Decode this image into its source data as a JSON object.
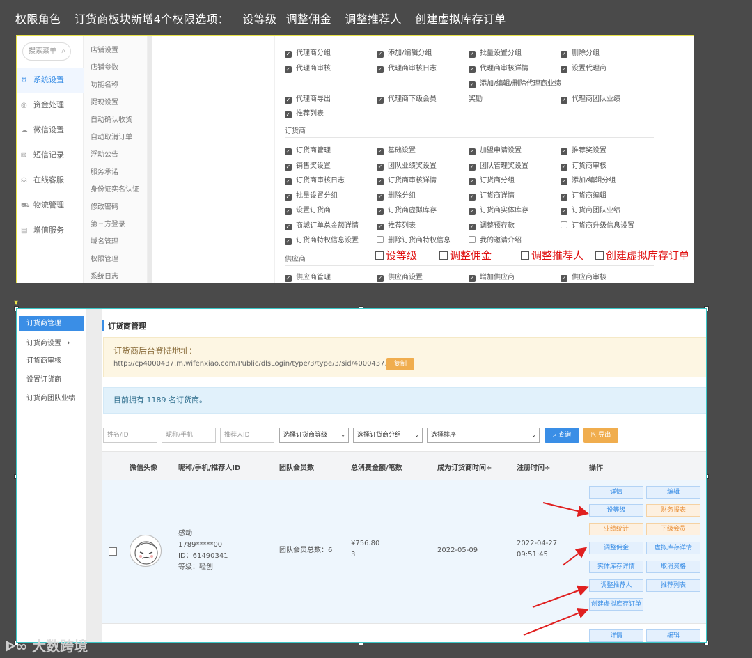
{
  "heading": {
    "part1": "权限角色",
    "part2": "订货商板块新增4个权限选项：",
    "part3": "设等级",
    "part4": "调整佣金",
    "part5": "调整推荐人",
    "part6": "创建虚拟库存订单"
  },
  "top_shot": {
    "search_placeholder": "搜索菜单",
    "nav": [
      {
        "label": "系统设置",
        "icon": "gear-icon",
        "active": true
      },
      {
        "label": "资金处理",
        "icon": "coin-icon"
      },
      {
        "label": "微信设置",
        "icon": "wechat-icon"
      },
      {
        "label": "短信记录",
        "icon": "mail-icon"
      },
      {
        "label": "在线客服",
        "icon": "headset-icon"
      },
      {
        "label": "物流管理",
        "icon": "truck-icon"
      },
      {
        "label": "增值服务",
        "icon": "chart-icon"
      }
    ],
    "subnav": [
      "店铺设置",
      "店铺参数",
      "功能名称",
      "提现设置",
      "自动确认收货",
      "自动取消订单",
      "浮动公告",
      "服务承诺",
      "身份证实名认证",
      "修改密码",
      "第三方登录",
      "域名管理",
      "权限管理",
      "系统日志"
    ],
    "agent_rows": [
      [
        "代理商分组",
        "添加/编辑分组",
        "批量设置分组",
        "删除分组"
      ],
      [
        "代理商审核",
        "代理商审核日志",
        "代理商审核详情",
        "设置代理商"
      ],
      [
        "",
        "",
        "添加/编辑/删除代理商业绩",
        ""
      ],
      [
        "代理商导出",
        "代理商下级会员",
        "奖励",
        "代理商团队业绩"
      ],
      [
        "推荐列表",
        "",
        "",
        ""
      ]
    ],
    "section_dealer": "订货商",
    "dealer_rows": [
      [
        "订货商管理",
        "基础设置",
        "加盟申请设置",
        "推荐奖设置"
      ],
      [
        "销售奖设置",
        "团队业绩奖设置",
        "团队管理奖设置",
        "订货商审核"
      ],
      [
        "订货商审核日志",
        "订货商审核详情",
        "订货商分组",
        "添加/编辑分组"
      ],
      [
        "批量设置分组",
        "删除分组",
        "订货商详情",
        "订货商编辑"
      ],
      [
        "设置订货商",
        "订货商虚拟库存",
        "订货商实体库存",
        "订货商团队业绩"
      ],
      [
        "商城订单总金额详情",
        "推荐列表",
        "调整预存款",
        "订货商升级信息设置"
      ],
      [
        "订货商特权信息设置",
        "删除订货商特权信息",
        "我的邀请介绍",
        ""
      ]
    ],
    "section_supplier": "供应商",
    "new_options": [
      "设等级",
      "调整佣金",
      "调整推荐人",
      "创建虚拟库存订单"
    ],
    "supplier_row": [
      "供应商管理",
      "供应商设置",
      "增加供应商",
      "供应商审核"
    ]
  },
  "bottom_shot": {
    "nav": [
      {
        "label": "订货商管理",
        "active": true
      },
      {
        "label": "订货商设置",
        "chevron": "›"
      },
      {
        "label": "订货商审核"
      },
      {
        "label": "设置订货商"
      },
      {
        "label": "订货商团队业绩"
      }
    ],
    "title": "订货商管理",
    "login_label": "订货商后台登陆地址：",
    "login_url": "http://cp4000437.m.wifenxiao.com/Public/dlsLogin/type/3/type/3/sid/4000437.html",
    "copy_label": "复制",
    "count_text": "目前拥有 1189 名订货商。",
    "filters": {
      "name_placeholder": "姓名/ID",
      "phone_placeholder": "昵称/手机",
      "referrer_placeholder": "推荐人ID",
      "level_select": "选择订货商等级",
      "group_select": "选择订货商分组",
      "sort_select": "选择排序",
      "search_label": "查询",
      "export_label": "导出"
    },
    "columns": [
      "微信头像",
      "昵称/手机/推荐人ID",
      "团队会员数",
      "总消费金额/笔数",
      "成为订货商时间÷",
      "注册时间÷",
      "操作"
    ],
    "row": {
      "nickname": "感动",
      "phone": "1789*****00",
      "id": "ID：61490341",
      "level": "等级：轻创",
      "team": "团队会员总数：6",
      "amount": "¥756.80",
      "count": "3",
      "become_date": "2022-05-09",
      "reg_date": "2022-04-27",
      "reg_time": "09:51:45"
    },
    "actions": [
      {
        "label": "详情",
        "style": "blue"
      },
      {
        "label": "编辑",
        "style": "blue"
      },
      {
        "label": "设等级",
        "style": "blue"
      },
      {
        "label": "财务报表",
        "style": "orange"
      },
      {
        "label": "业绩统计",
        "style": "orange"
      },
      {
        "label": "下级会员",
        "style": "orange"
      },
      {
        "label": "调整佣金",
        "style": "blue"
      },
      {
        "label": "虚拟库存详情",
        "style": "blue"
      },
      {
        "label": "实体库存详情",
        "style": "blue"
      },
      {
        "label": "取消资格",
        "style": "blue"
      },
      {
        "label": "调整推荐人",
        "style": "blue"
      },
      {
        "label": "推荐列表",
        "style": "blue"
      },
      {
        "label": "创建虚拟库存订单",
        "style": "blue"
      }
    ],
    "next_row_actions": [
      "详情",
      "编辑"
    ]
  },
  "watermark": "大数跨境",
  "colors": {
    "accent": "#3a8ee6",
    "warning": "#f0ad4e",
    "highlight": "#e01010",
    "arrow": "#e02020"
  }
}
